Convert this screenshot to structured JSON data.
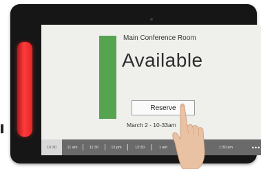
{
  "room": {
    "name": "Main Conference Room",
    "status": "Available",
    "status_color": "#56a450"
  },
  "actions": {
    "reserve_label": "Reserve"
  },
  "booking": {
    "datetime": "March 2 - 10-33am"
  },
  "timeline": {
    "slots": [
      "10:30",
      "11 am",
      "11:30",
      "12 pm",
      "12:30",
      "1 am",
      "1:30 am"
    ],
    "current_index": 0,
    "more_label": "•••"
  },
  "device": {
    "led_color": "#ff3b3b"
  },
  "icons": [
    "camera-icon",
    "more-options-icon"
  ]
}
